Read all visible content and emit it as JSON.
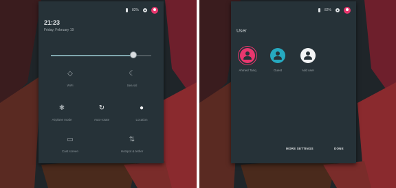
{
  "colors": {
    "panel": "#263238",
    "accent": "#e8376e",
    "guest": "#26a9c0",
    "track_fill": "#7fa6ae"
  },
  "left_panel": {
    "status": {
      "battery_pct": "82%"
    },
    "clock": "21:23",
    "date": "Friday, February 19",
    "brightness": {
      "level": 0.82
    },
    "tiles": [
      {
        "icon": "wifi-icon",
        "glyph": "◇",
        "label": "WiFi"
      },
      {
        "icon": "moon-icon",
        "glyph": "☾",
        "label": "Sea ssl"
      },
      {
        "icon": "bluetooth-icon",
        "glyph": "✱",
        "label": "Airplane mode"
      },
      {
        "icon": "rotate-icon",
        "glyph": "↻",
        "label": "Auto-rotate"
      },
      {
        "icon": "location-icon",
        "glyph": "●",
        "label": "Location"
      },
      {
        "icon": "cast-icon",
        "glyph": "▭",
        "label": "Cast screen"
      },
      {
        "icon": "hotspot-icon",
        "glyph": "⇅",
        "label": "Hotspot & tether"
      }
    ]
  },
  "right_panel": {
    "status": {
      "battery_pct": "82%"
    },
    "title": "User",
    "users": [
      {
        "name": "Ahmed Tariq",
        "color": "#e8376e"
      },
      {
        "name": "Guest",
        "color": "#26a9c0"
      },
      {
        "name": "Add user",
        "color": "#f2f4f5"
      }
    ],
    "more_settings": "MORE SETTINGS",
    "done": "DONE"
  }
}
